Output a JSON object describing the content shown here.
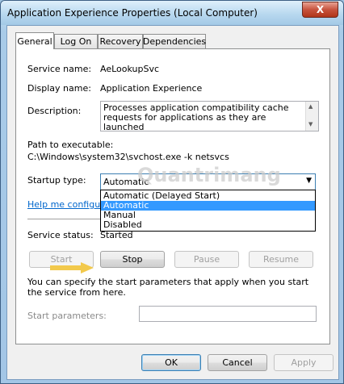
{
  "window": {
    "title": "Application Experience Properties (Local Computer)",
    "close": "X"
  },
  "tabs": [
    {
      "label": "General"
    },
    {
      "label": "Log On"
    },
    {
      "label": "Recovery"
    },
    {
      "label": "Dependencies"
    }
  ],
  "general": {
    "service_name_label": "Service name:",
    "service_name": "AeLookupSvc",
    "display_name_label": "Display name:",
    "display_name": "Application Experience",
    "description_label": "Description:",
    "description": "Processes application compatibility cache requests for applications as they are launched",
    "path_label": "Path to executable:",
    "path": "C:\\Windows\\system32\\svchost.exe -k netsvcs",
    "startup_type_label": "Startup type:",
    "startup_type_value": "Automatic",
    "startup_options": [
      "Automatic (Delayed Start)",
      "Automatic",
      "Manual",
      "Disabled"
    ],
    "help_link": "Help me configure s",
    "service_status_label": "Service status:",
    "service_status": "Started",
    "start_button": "Start",
    "stop_button": "Stop",
    "pause_button": "Pause",
    "resume_button": "Resume",
    "info_text": "You can specify the start parameters that apply when you start the service from here.",
    "start_params_label": "Start parameters:"
  },
  "footer": {
    "ok": "OK",
    "cancel": "Cancel",
    "apply": "Apply"
  },
  "watermark": "Quantrimang",
  "colors": {
    "accent": "#3399ff",
    "link": "#0066cc",
    "arrow": "#f2c94c"
  }
}
